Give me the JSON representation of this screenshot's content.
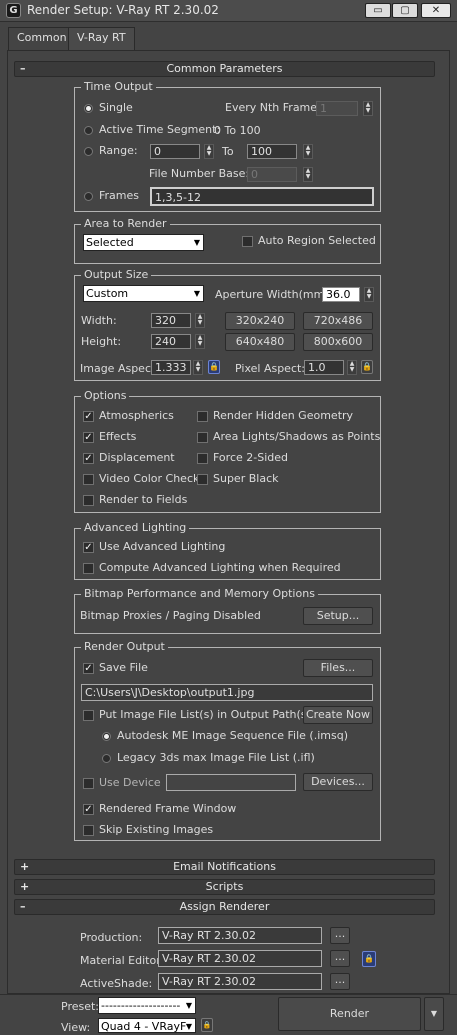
{
  "window": {
    "title": "Render Setup: V-Ray RT 2.30.02",
    "app_icon": "3ds-max-logo",
    "btn_min": "▭",
    "btn_max": "▢",
    "btn_close": "✕"
  },
  "tabs": [
    "Common",
    "V-Ray RT"
  ],
  "common_params": {
    "header": "Common Parameters",
    "toggle": "–",
    "time_output": {
      "title": "Time Output",
      "single": "Single",
      "every_nth_label": "Every Nth Frame:",
      "every_nth_value": "1",
      "active_segment": "Active Time Segment:",
      "active_segment_value": "0 To 100",
      "range": "Range:",
      "range_from": "0",
      "range_to_label": "To",
      "range_to": "100",
      "file_number_base": "File Number Base:",
      "file_number_base_value": "0",
      "frames": "Frames",
      "frames_value": "1,3,5-12"
    },
    "area": {
      "title": "Area to Render",
      "selected": "Selected",
      "auto_region": "Auto Region Selected"
    },
    "output_size": {
      "title": "Output Size",
      "preset": "Custom",
      "aperture_label": "Aperture Width(mm):",
      "aperture_value": "36.0",
      "width_label": "Width:",
      "width_value": "320",
      "height_label": "Height:",
      "height_value": "240",
      "presets": [
        "320x240",
        "720x486",
        "640x480",
        "800x600"
      ],
      "image_aspect_label": "Image Aspect:",
      "image_aspect_value": "1.333",
      "pixel_aspect_label": "Pixel Aspect:",
      "pixel_aspect_value": "1.0"
    },
    "options": {
      "title": "Options",
      "items": [
        {
          "label": "Atmospherics",
          "checked": true
        },
        {
          "label": "Render Hidden Geometry",
          "checked": false
        },
        {
          "label": "Effects",
          "checked": true
        },
        {
          "label": "Area Lights/Shadows as Points",
          "checked": false
        },
        {
          "label": "Displacement",
          "checked": true
        },
        {
          "label": "Force 2-Sided",
          "checked": false
        },
        {
          "label": "Video Color Check",
          "checked": false
        },
        {
          "label": "Super Black",
          "checked": false
        },
        {
          "label": "Render to Fields",
          "checked": false
        }
      ]
    },
    "advanced_lighting": {
      "title": "Advanced Lighting",
      "use": "Use Advanced Lighting",
      "compute": "Compute Advanced Lighting when Required"
    },
    "bitmap": {
      "title": "Bitmap Performance and Memory Options",
      "status": "Bitmap Proxies / Paging Disabled",
      "setup": "Setup..."
    },
    "render_output": {
      "title": "Render Output",
      "save_file": "Save File",
      "files_btn": "Files...",
      "path": "C:\\Users\\J\\Desktop\\output1.jpg",
      "put_list": "Put Image File List(s) in Output Path(s)",
      "create_now": "Create Now",
      "autodesk_me": "Autodesk ME Image Sequence File (.imsq)",
      "legacy": "Legacy 3ds max Image File List (.ifl)",
      "use_device": "Use Device",
      "devices_btn": "Devices...",
      "rendered_frame": "Rendered Frame Window",
      "skip_existing": "Skip Existing Images"
    }
  },
  "rollouts": {
    "email": "Email Notifications",
    "scripts": "Scripts",
    "assign": "Assign Renderer",
    "plus": "+",
    "minus": "–"
  },
  "assign": {
    "production_label": "Production:",
    "production_value": "V-Ray RT 2.30.02",
    "material_label": "Material Editor:",
    "material_value": "V-Ray RT 2.30.02",
    "activeshade_label": "ActiveShade:",
    "activeshade_value": "V-Ray RT 2.30.02",
    "browse": "..."
  },
  "bottom": {
    "preset_label": "Preset:",
    "preset_value": "--------------------",
    "view_label": "View:",
    "view_value": "Quad 4 - VRayF",
    "render_btn": "Render",
    "dropdown_arrow": "▼"
  },
  "icons": {
    "lock": "lock-icon",
    "spinner": "spinner-arrows"
  }
}
